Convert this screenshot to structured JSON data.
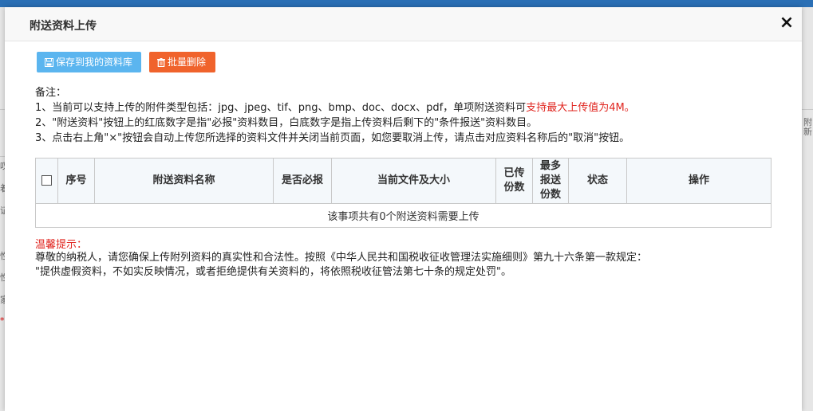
{
  "modal": {
    "title": "附送资料上传",
    "close_glyph": "×"
  },
  "toolbar": {
    "save_label": "保存到我的资料库",
    "delete_label": "批量删除"
  },
  "notes": {
    "heading": "备注：",
    "line1_prefix": "1、当前可以支持上传的附件类型包括：jpg、jpeg、tif、png、bmp、doc、docx、pdf，单项附送资料可",
    "line1_highlight": "支持最大上传值为4M。",
    "line2": "2、\"附送资料\"按钮上的红底数字是指\"必报\"资料数目，白底数字是指上传资料后剩下的\"条件报送\"资料数目。",
    "line3": "3、点击右上角\"×\"按钮会自动上传您所选择的资料文件并关闭当前页面，如您要取消上传，请点击对应资料名称后的\"取消\"按钮。"
  },
  "table": {
    "headers": {
      "seq": "序号",
      "name": "附送资料名称",
      "required": "是否必报",
      "file": "当前文件及大小",
      "uploaded_l1": "已传",
      "uploaded_l2": "份数",
      "max_l1": "最多",
      "max_l2": "报送",
      "max_l3": "份数",
      "status": "状态",
      "action": "操作"
    },
    "empty_message": "该事项共有0个附送资料需要上传"
  },
  "warning": {
    "title": "温馨提示：",
    "line1": "尊敬的纳税人，请您确保上传附列资料的真实性和合法性。按照《中华人民共和国税收征收管理法实施细则》第九十六条第一款规定：",
    "line2": "\"提供虚假资料，不如实反映情况，或者拒绝提供有关资料的，将依照税收征管法第七十条的规定处罚\"。"
  },
  "background": {
    "glyphs": [
      "叹",
      "着",
      "证",
      "性",
      "性",
      "家",
      "*"
    ],
    "right_glyph": "附新"
  },
  "colors": {
    "save_button": "#5bb5ef",
    "delete_button": "#f0632c",
    "highlight_red": "#e0251f"
  }
}
